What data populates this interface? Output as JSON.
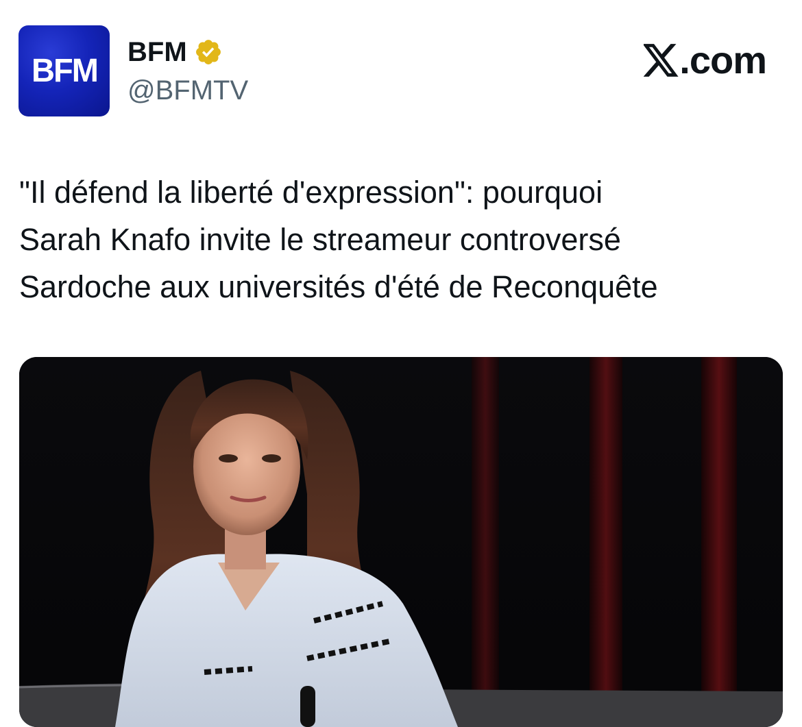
{
  "tweet": {
    "author": {
      "avatar_text": "BFM",
      "display_name": "BFM",
      "handle": "@BFMTV",
      "verified_badge_icon": "verified-gold-checkmark-icon"
    },
    "brand": {
      "logo_icon": "x-logo-icon",
      "suffix": ".com"
    },
    "headline": {
      "lines": [
        "\"Il défend la liberté d'expression\": pourquoi",
        "Sarah Knafo invite le streameur controversé",
        "Sardoche aux universités d'été de Reconquête"
      ]
    },
    "media": {
      "type": "photo"
    }
  },
  "colors": {
    "avatar_blue": "#1424b8",
    "badge_gold": "#e2b719",
    "text_primary": "#0f1419",
    "text_secondary": "#536471",
    "curtain_red": "#5a0d10"
  }
}
